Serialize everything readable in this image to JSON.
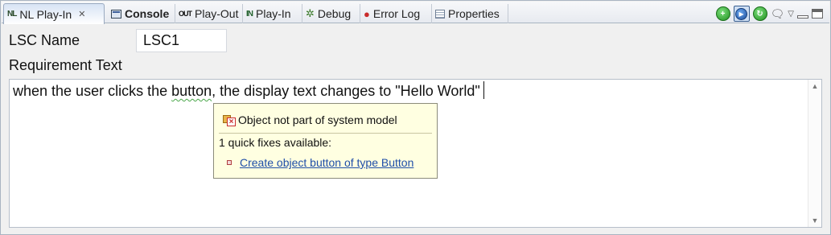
{
  "tabs": [
    {
      "label": "NL Play-In",
      "icon": "nl-icon",
      "icon_text": "NL",
      "active": true,
      "closable": true
    },
    {
      "label": "Console",
      "icon": "console-icon",
      "bold": true
    },
    {
      "label": "Play-Out",
      "icon": "out-icon",
      "icon_text": "OUT"
    },
    {
      "label": "Play-In",
      "icon": "in-icon",
      "icon_text": "IN"
    },
    {
      "label": "Debug",
      "icon": "bug-icon"
    },
    {
      "label": "Error Log",
      "icon": "error-log-icon"
    },
    {
      "label": "Properties",
      "icon": "properties-icon"
    }
  ],
  "toolbar": {
    "icons": [
      "add-green-icon",
      "play-blue-icon",
      "refresh-green-icon",
      "speech-bubble-icon",
      "view-menu-icon",
      "minimize-icon",
      "maximize-icon"
    ]
  },
  "form": {
    "lsc_name_label": "LSC Name",
    "lsc_name_value": "LSC1",
    "requirement_label": "Requirement Text"
  },
  "editor": {
    "text_before": "when the user clicks the ",
    "squiggle_word": "button",
    "text_after": ", the display text changes to \"Hello World\""
  },
  "quickfix": {
    "problem": "Object not part of system model",
    "summary": "1 quick fixes available:",
    "fix": "Create object button of type Button"
  },
  "colors": {
    "popup_bg": "#ffffe1",
    "link": "#1f4ea8",
    "squiggle": "#4aa74a"
  }
}
